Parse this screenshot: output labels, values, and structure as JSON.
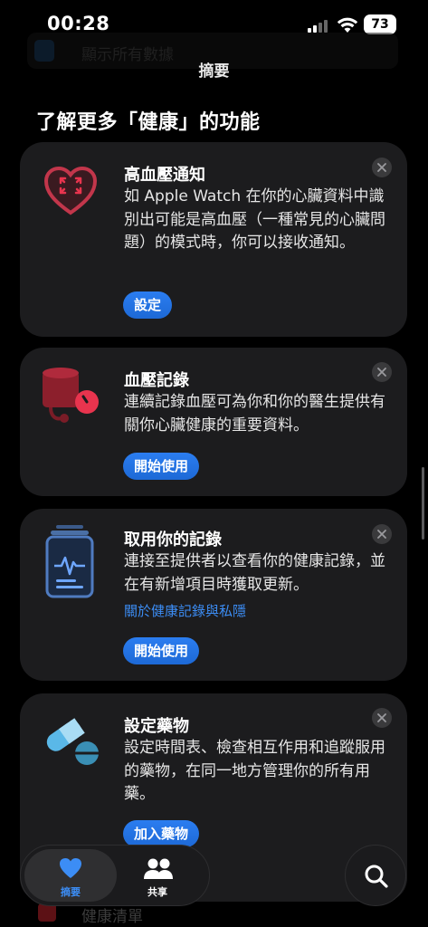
{
  "status": {
    "time": "00:28",
    "battery": "73"
  },
  "behind_header_text": "顯示所有數據",
  "nav": {
    "title": "摘要"
  },
  "section": {
    "title": "了解更多「健康」的功能"
  },
  "cards": [
    {
      "title": "高血壓通知",
      "body": "如 Apple Watch 在你的心臟資料中識別出可能是高血壓（一種常見的心臟問題）的模式時，你可以接收通知。",
      "button": "設定",
      "icon": "heart-arrows-icon"
    },
    {
      "title": "血壓記錄",
      "body": "連續記錄血壓可為你和你的醫生提供有關你心臟健康的重要資料。",
      "button": "開始使用",
      "icon": "blood-pressure-cuff-icon"
    },
    {
      "title": "取用你的記錄",
      "body": "連接至提供者以查看你的健康記錄，並在有新增項目時獲取更新。",
      "link": "關於健康記錄與私隱",
      "button": "開始使用",
      "icon": "health-records-icon"
    },
    {
      "title": "設定藥物",
      "body": "設定時間表、檢查相互作用和追蹤服用的藥物，在同一地方管理你的所有用藥。",
      "button": "加入藥物",
      "icon": "pills-icon"
    }
  ],
  "bottom_behind_text": "健康清單",
  "tabbar": {
    "tabs": [
      {
        "label": "摘要",
        "icon": "heart-icon",
        "active": true
      },
      {
        "label": "共享",
        "icon": "people-icon",
        "active": false
      }
    ]
  },
  "colors": {
    "accent": "#3c8df5",
    "card": "#1c1c1e",
    "heart_red": "#e8344e"
  }
}
